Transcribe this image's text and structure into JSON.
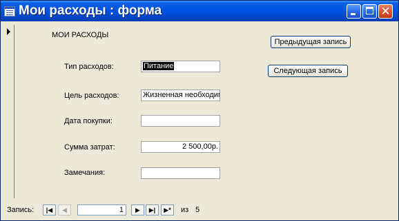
{
  "window": {
    "title": "Мои расходы : форма"
  },
  "form": {
    "section_title": "МОИ РАСХОДЫ",
    "fields": [
      {
        "label": "Тип расходов:",
        "value": "Питание"
      },
      {
        "label": "Цель расходов:",
        "value": "Жизненная необходимость"
      },
      {
        "label": "Дата покупки:",
        "value": ""
      },
      {
        "label": "Сумма затрат:",
        "value": "2 500,00р."
      },
      {
        "label": "Замечания:",
        "value": ""
      }
    ],
    "buttons": {
      "prev_label": "Предыдущая запись",
      "next_label": "Следующая запись"
    }
  },
  "navigation": {
    "record_label": "Запись:",
    "current_record": "1",
    "of_label": "из",
    "total_records": "5",
    "first_icon": "first-record-icon",
    "prev_icon": "previous-record-icon",
    "next_icon": "next-record-icon",
    "last_icon": "last-record-icon",
    "new_icon": "new-record-icon"
  },
  "colors": {
    "titlebar": "#0054e3",
    "background": "#ece9d8",
    "close_button": "#d9502a"
  }
}
